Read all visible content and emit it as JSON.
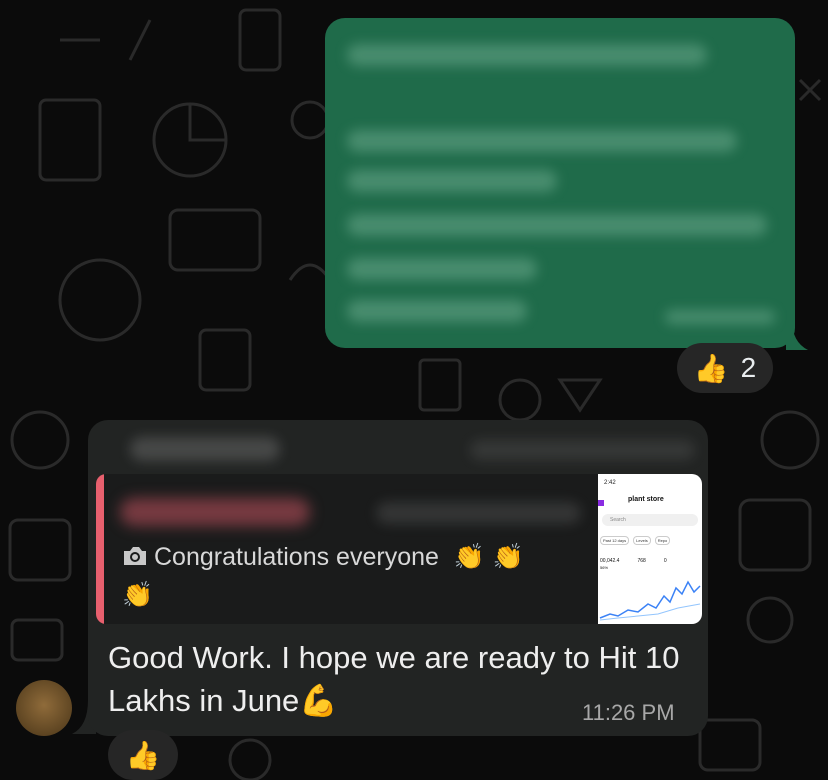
{
  "outgoing_message": {
    "reaction": {
      "emoji": "👍",
      "count": "2"
    }
  },
  "incoming_message": {
    "quoted": {
      "text": "Congratulations everyone",
      "emojis": "👏 👏",
      "emoji_line2": "👏",
      "icon": "camera-icon",
      "thumbnail": {
        "status_time": "2:42",
        "app_title": "plant store",
        "search": "Search",
        "filters": [
          "Past 12 days",
          "Levels",
          "Repo"
        ],
        "metrics": [
          "00,042.4",
          "768",
          "0"
        ],
        "metrics_sub": "56%"
      }
    },
    "text": "Good Work. I hope we are ready to Hit 10 Lakhs in June",
    "text_emoji": "💪",
    "time": "11:26 PM",
    "reaction": {
      "emoji": "👍"
    }
  },
  "colors": {
    "background": "#0b0b0b",
    "outgoing_bubble": "#1f6b4a",
    "incoming_bubble": "#222423",
    "quote_accent": "#e8606e"
  }
}
